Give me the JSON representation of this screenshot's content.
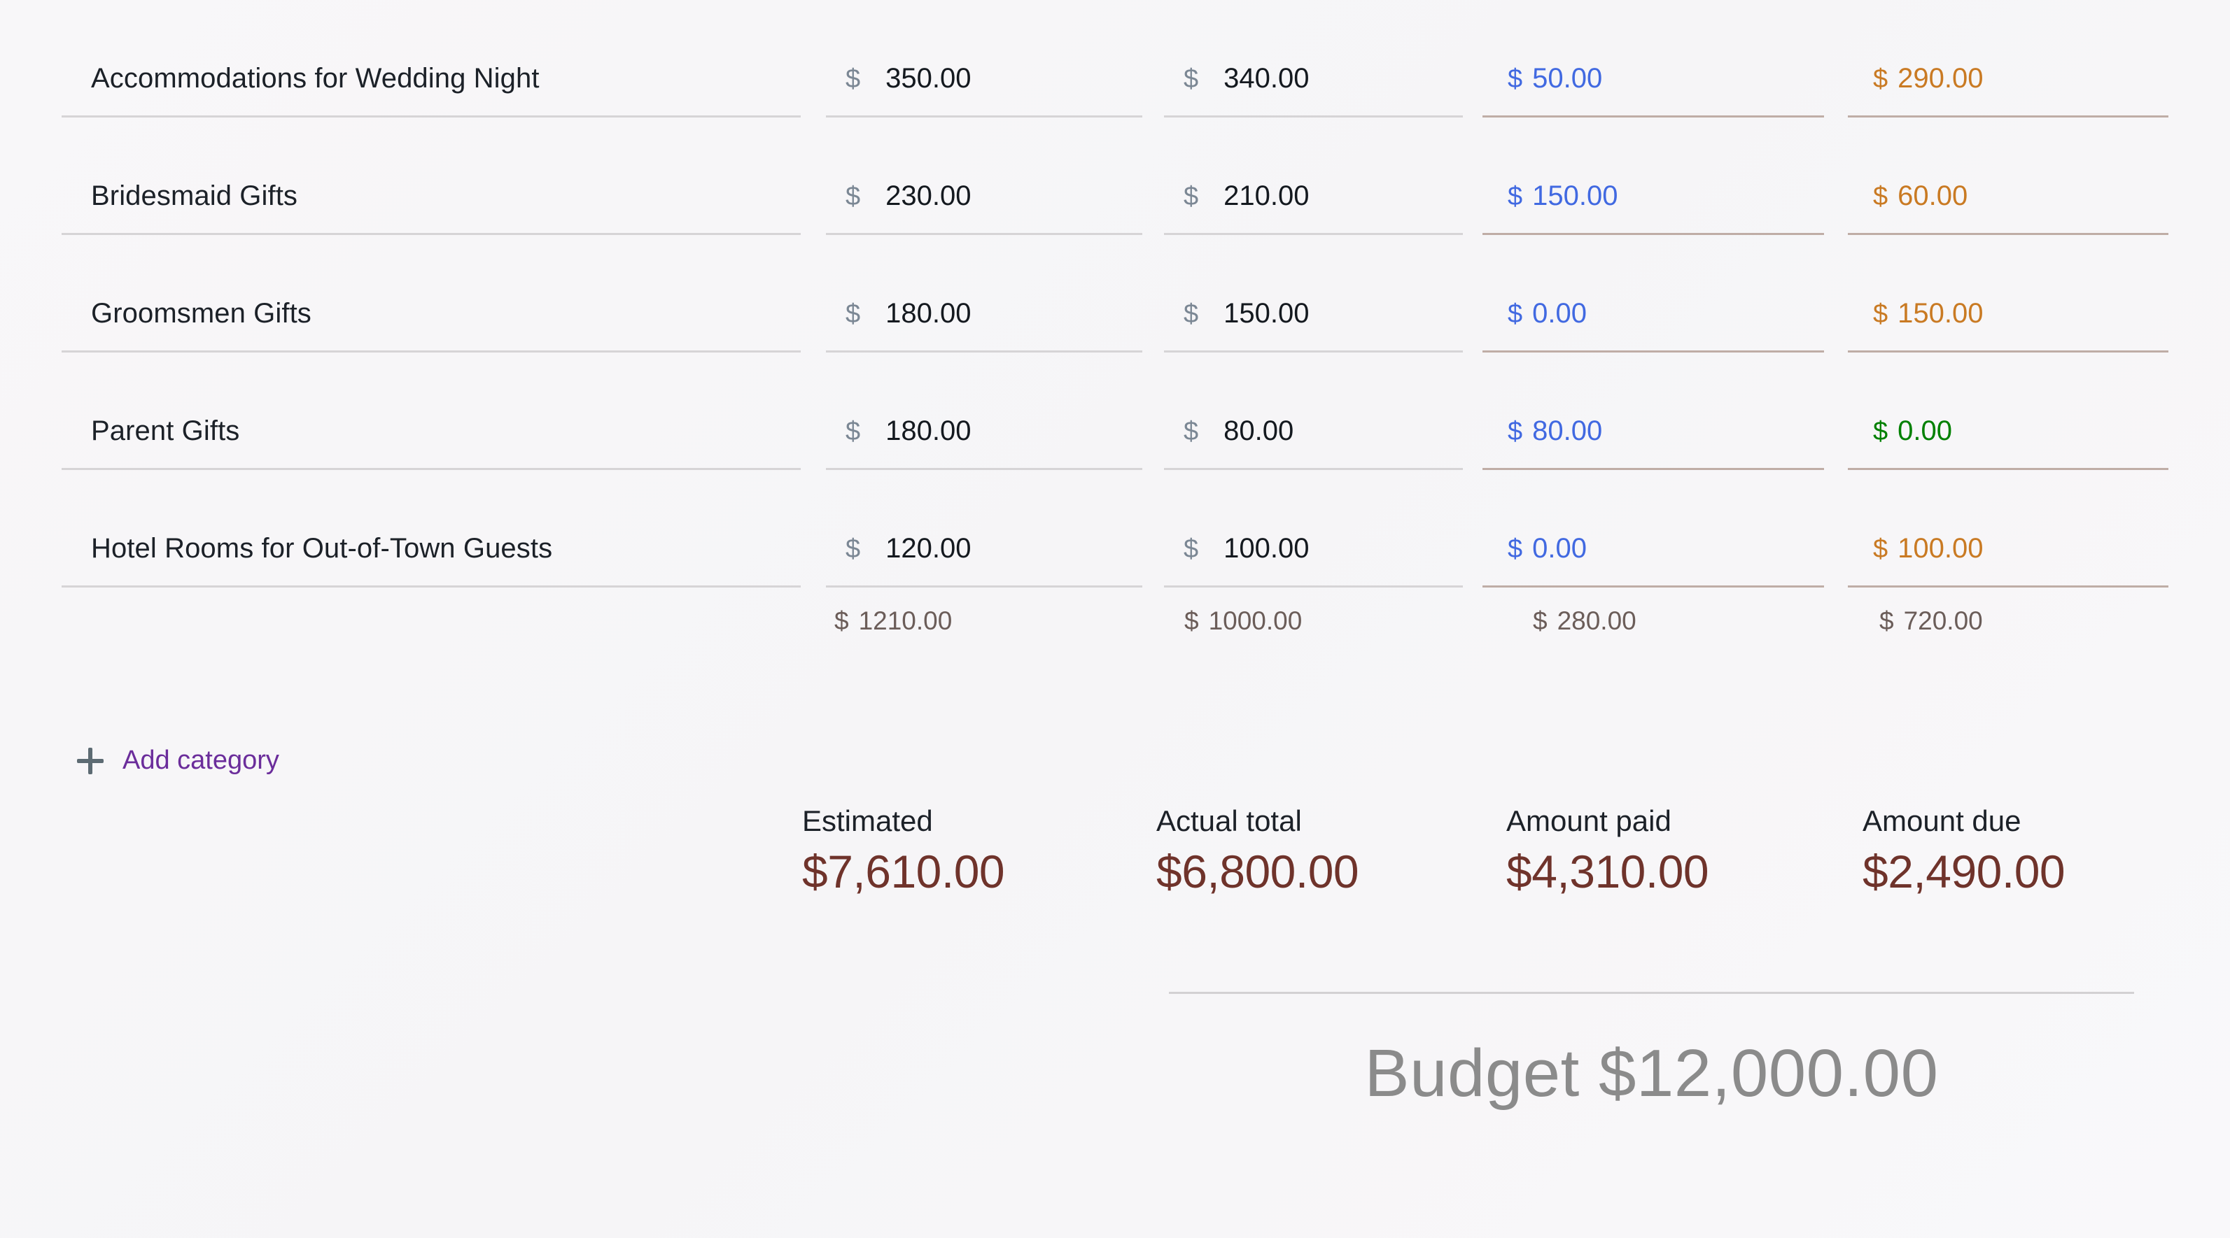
{
  "table": {
    "rows": [
      {
        "category": "Accommodations for Wedding Night",
        "estimated": {
          "symbol": "$",
          "amount": "350.00"
        },
        "actual": {
          "symbol": "$",
          "amount": "340.00"
        },
        "paid": {
          "symbol": "$",
          "amount": "50.00",
          "color": "blue"
        },
        "due": {
          "symbol": "$",
          "amount": "290.00",
          "color": "orange"
        }
      },
      {
        "category": "Bridesmaid Gifts",
        "estimated": {
          "symbol": "$",
          "amount": "230.00"
        },
        "actual": {
          "symbol": "$",
          "amount": "210.00"
        },
        "paid": {
          "symbol": "$",
          "amount": "150.00",
          "color": "blue"
        },
        "due": {
          "symbol": "$",
          "amount": "60.00",
          "color": "orange"
        }
      },
      {
        "category": "Groomsmen Gifts",
        "estimated": {
          "symbol": "$",
          "amount": "180.00"
        },
        "actual": {
          "symbol": "$",
          "amount": "150.00"
        },
        "paid": {
          "symbol": "$",
          "amount": "0.00",
          "color": "blue"
        },
        "due": {
          "symbol": "$",
          "amount": "150.00",
          "color": "orange"
        }
      },
      {
        "category": "Parent Gifts",
        "estimated": {
          "symbol": "$",
          "amount": "180.00"
        },
        "actual": {
          "symbol": "$",
          "amount": "80.00"
        },
        "paid": {
          "symbol": "$",
          "amount": "80.00",
          "color": "blue"
        },
        "due": {
          "symbol": "$",
          "amount": "0.00",
          "color": "green"
        }
      },
      {
        "category": "Hotel Rooms for Out-of-Town Guests",
        "estimated": {
          "symbol": "$",
          "amount": "120.00"
        },
        "actual": {
          "symbol": "$",
          "amount": "100.00"
        },
        "paid": {
          "symbol": "$",
          "amount": "0.00",
          "color": "blue"
        },
        "due": {
          "symbol": "$",
          "amount": "100.00",
          "color": "orange"
        }
      }
    ],
    "subtotals": {
      "symbol": "$",
      "estimated": "1210.00",
      "actual": "1000.00",
      "paid": "280.00",
      "due": "720.00"
    }
  },
  "add_category": {
    "icon": "plus-icon",
    "label": "Add category"
  },
  "summary": {
    "estimated": {
      "label": "Estimated",
      "value": "$7,610.00"
    },
    "actual": {
      "label": "Actual total",
      "value": "$6,800.00"
    },
    "paid": {
      "label": "Amount paid",
      "value": "$4,310.00"
    },
    "due": {
      "label": "Amount due",
      "value": "$2,490.00"
    }
  },
  "budget": {
    "text": "Budget $12,000.00"
  },
  "colors": {
    "background": "#f7f6f8",
    "category_text": "#1c2128",
    "amount_text": "#14191f",
    "currency_symbol": "#7b8794",
    "paid_blue": "#4169e1",
    "due_orange": "#c97a23",
    "due_green": "#018001",
    "subtotal_text": "#6b5d59",
    "summary_value": "#6f332b",
    "add_category_purple": "#6b2d9b",
    "plus_icon": "#5d6b73",
    "underline_plain": "#d6d4d6",
    "underline_tinted": "#bfada6",
    "budget_total": "#8b8b8b"
  }
}
